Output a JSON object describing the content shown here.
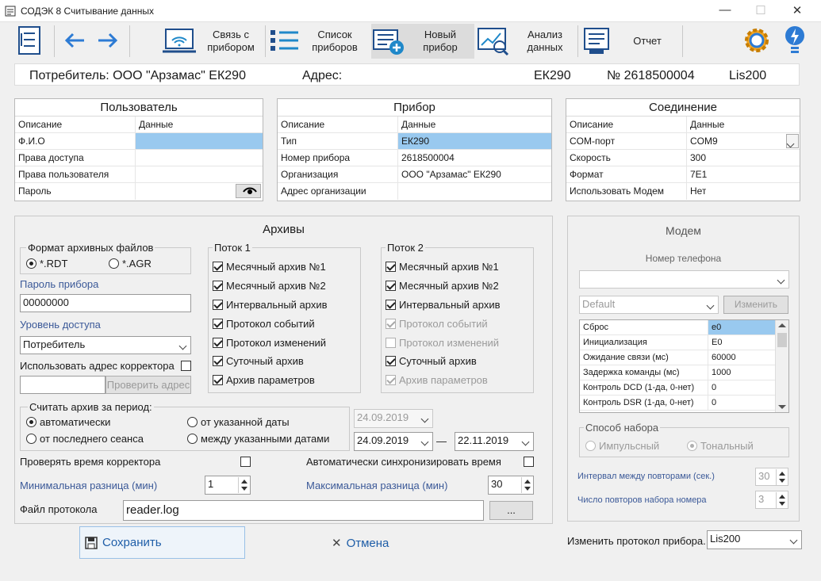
{
  "window": {
    "title": "СОДЭК 8 Считывание данных"
  },
  "toolbar": {
    "connect": "Связь с прибором",
    "list": "Список приборов",
    "new": "Новый прибор",
    "analysis": "Анализ данных",
    "report": "Отчет"
  },
  "info": {
    "consumer": "Потребитель: ООО \"Арзамас\" ЕК290",
    "address": "Адрес:",
    "model": "ЕК290",
    "number": "№ 2618500004",
    "protocol": "Lis200"
  },
  "user": {
    "title": "Пользователь",
    "h1": "Описание",
    "h2": "Данные",
    "rows": [
      [
        "Ф.И.О",
        ""
      ],
      [
        "Права доступа",
        ""
      ],
      [
        "Права пользователя",
        ""
      ],
      [
        "Пароль",
        ""
      ]
    ]
  },
  "device": {
    "title": "Прибор",
    "h1": "Описание",
    "h2": "Данные",
    "rows": [
      [
        "Тип",
        "ЕК290"
      ],
      [
        "Номер прибора",
        "2618500004"
      ],
      [
        "Организация",
        "ООО \"Арзамас\" ЕК290"
      ],
      [
        "Адрес организации",
        ""
      ]
    ]
  },
  "conn": {
    "title": "Соединение",
    "h1": "Описание",
    "h2": "Данные",
    "rows": [
      [
        "COM-порт",
        "COM9"
      ],
      [
        "Скорость",
        "300"
      ],
      [
        "Формат",
        "7E1"
      ],
      [
        "Использовать Модем",
        "Нет"
      ]
    ]
  },
  "arch": {
    "title": "Архивы",
    "fmt_title": "Формат архивных файлов",
    "fmt_rdt": "*.RDT",
    "fmt_agr": "*.AGR",
    "pwd_label": "Пароль прибора",
    "pwd": "00000000",
    "level_label": "Уровень доступа",
    "level": "Потребитель",
    "use_addr": "Использовать адрес корректора",
    "check_addr": "Проверить адрес",
    "s1": "Поток 1",
    "s2": "Поток 2",
    "items": [
      "Месячный архив №1",
      "Месячный архив №2",
      "Интервальный архив",
      "Протокол событий",
      "Протокол изменений",
      "Суточный архив",
      "Архив параметров"
    ],
    "period_title": "Считать архив за период:",
    "auto": "автоматически",
    "from_date": "от указанной даты",
    "last": "от последнего сеанса",
    "between": "между указанными датами",
    "date0": "24.09.2019",
    "date1": "24.09.2019",
    "date_sep": "—",
    "date2": "22.11.2019",
    "check_time": "Проверять время корректора",
    "auto_sync": "Автоматически синхронизировать время",
    "min_label": "Минимальная разница (мин)",
    "min_val": "1",
    "max_label": "Максимальная разница (мин)",
    "max_val": "30",
    "log_label": "Файл протокола",
    "log": "reader.log",
    "browse": "..."
  },
  "modem": {
    "title": "Модем",
    "phone_label": "Номер телефона",
    "default": "Default",
    "change": "Изменить",
    "rows": [
      [
        "Сброс",
        "e0"
      ],
      [
        "Инициализация",
        "E0"
      ],
      [
        "Ожидание связи (мс)",
        "60000"
      ],
      [
        "Задержка команды (мс)",
        "1000"
      ],
      [
        "Контроль DCD (1-да, 0-нет)",
        "0"
      ],
      [
        "Контроль DSR (1-да, 0-нет)",
        "0"
      ]
    ],
    "dial_title": "Способ набора",
    "pulse": "Импульсный",
    "tone": "Тональный",
    "interval_label": "Интервал между повторами (сек.)",
    "interval": "30",
    "count_label": "Число повторов набора номера",
    "count": "3"
  },
  "bottom": {
    "save": "Сохранить",
    "cancel": "Отмена",
    "change_proto": "Изменить протокол прибора.",
    "proto": "Lis200"
  }
}
